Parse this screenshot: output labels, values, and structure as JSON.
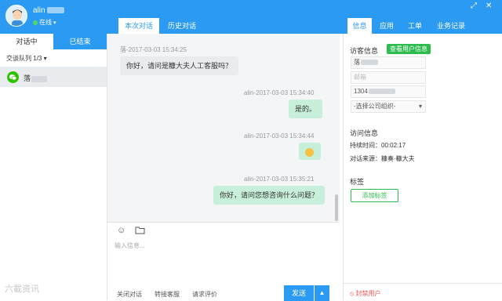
{
  "user": {
    "name": "alin",
    "status": "在线",
    "status_caret": "▾"
  },
  "window_controls": [
    "⤢",
    "✕"
  ],
  "chat_tabs": [
    {
      "label": "本次对话"
    },
    {
      "label": "历史对话"
    }
  ],
  "side_tabs": [
    {
      "label": "信息"
    },
    {
      "label": "应用"
    },
    {
      "label": "工单"
    },
    {
      "label": "业务记录"
    }
  ],
  "left": {
    "tabs": [
      {
        "label": "对话中"
      },
      {
        "label": "已结束"
      }
    ],
    "queue": "交谈队列 1/3 ▾",
    "visitor_name": "落"
  },
  "messages": [
    {
      "meta": "落-2017-03-03 15:34:25",
      "text": "你好，请问是糠大夫人工客服吗？",
      "dir": "in"
    },
    {
      "meta": "alin-2017-03-03 15:34:40",
      "text": "是的。",
      "dir": "out"
    },
    {
      "meta": "alin-2017-03-03 15:34:44",
      "text": "",
      "dir": "out",
      "emoji": "smile-icon"
    },
    {
      "meta": "alin-2017-03-03 15:35:21",
      "text": "你好，请问您想咨询什么问题？",
      "dir": "out"
    }
  ],
  "input": {
    "placeholder": "输入信息..."
  },
  "actions": {
    "close": "关闭对话",
    "transfer": "转接客服",
    "rate": "请求评价",
    "send": "发送",
    "send_caret": "▲"
  },
  "visitor_info": {
    "title": "访客信息",
    "badge": "查看用户信息",
    "name_value": "落",
    "email_placeholder": "邮箱",
    "phone_value": "1304",
    "company_placeholder": "-选择公司组织-"
  },
  "visit_info": {
    "title": "访问信息",
    "duration": "持续时间：00:02:17",
    "source": "对话来源：糠奏·糠大夫"
  },
  "tags": {
    "title": "标签",
    "add": "添加标签"
  },
  "ban": "⦸ 封禁用户",
  "watermark": "六載资讯"
}
